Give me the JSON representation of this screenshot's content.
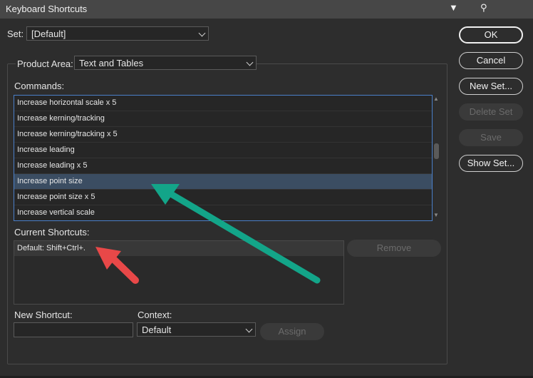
{
  "window": {
    "title": "Keyboard Shortcuts"
  },
  "set": {
    "label": "Set:",
    "value": "[Default]"
  },
  "product_area": {
    "label": "Product Area:",
    "value": "Text and Tables"
  },
  "commands": {
    "label": "Commands:",
    "items": [
      "Increase horizontal scale x 5",
      "Increase kerning/tracking",
      "Increase kerning/tracking x 5",
      "Increase leading",
      "Increase leading x 5",
      "Increase point size",
      "Increase point size x 5",
      "Increase vertical scale"
    ],
    "selected_index": 5
  },
  "current_shortcuts": {
    "label": "Current Shortcuts:",
    "items": [
      "Default: Shift+Ctrl+."
    ]
  },
  "new_shortcut": {
    "label": "New Shortcut:",
    "value": ""
  },
  "context": {
    "label": "Context:",
    "value": "Default"
  },
  "buttons": {
    "ok": "OK",
    "cancel": "Cancel",
    "new_set": "New Set...",
    "delete_set": "Delete Set",
    "save": "Save",
    "show_set": "Show Set...",
    "remove": "Remove",
    "assign": "Assign"
  },
  "annotations": {
    "green_arrow_color": "#13a589",
    "red_arrow_color": "#e84848"
  }
}
